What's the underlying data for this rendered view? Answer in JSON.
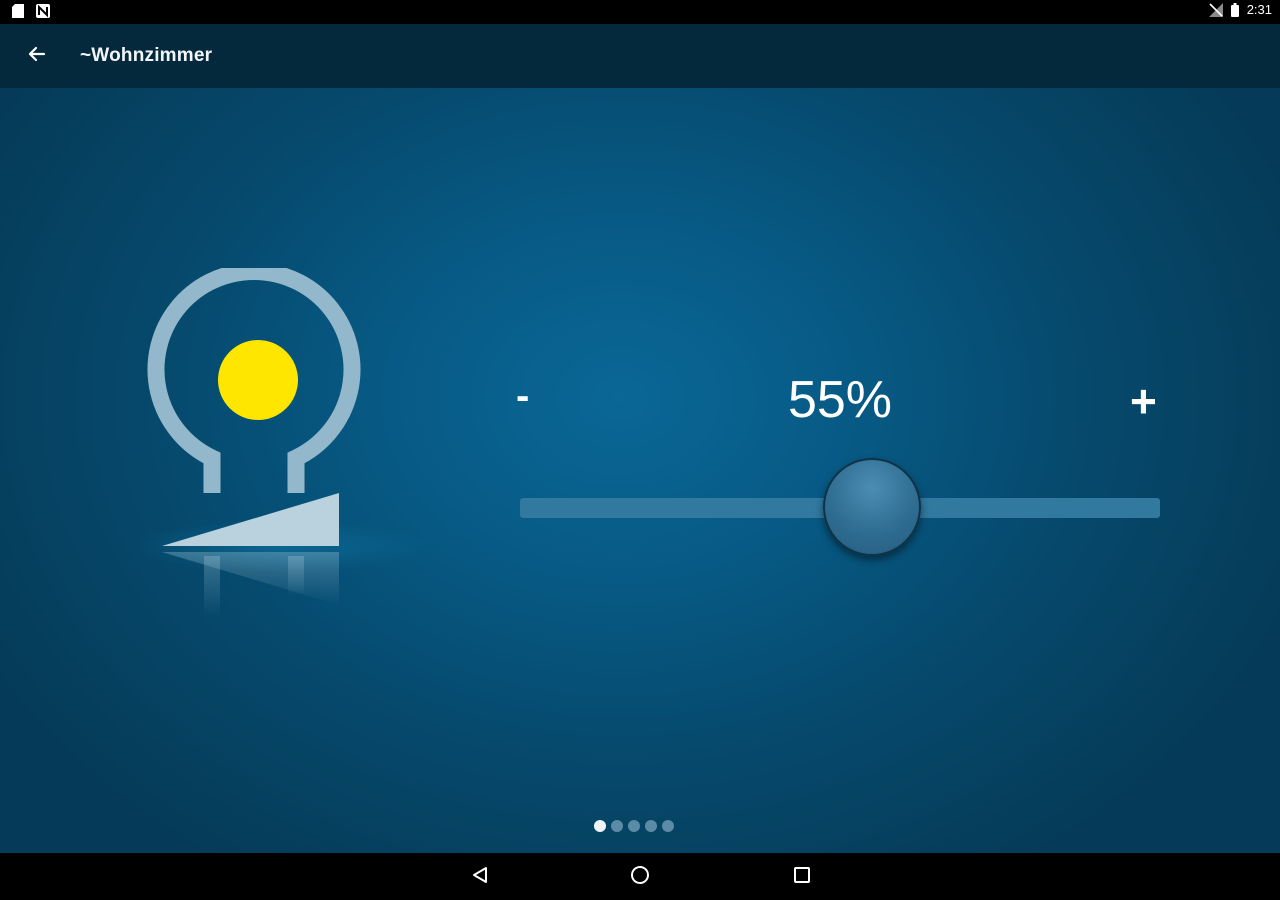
{
  "status_bar": {
    "time": "2:31",
    "left_icons": [
      "sd-card-icon",
      "nfc-icon"
    ],
    "right_icons": [
      "no-signal-icon",
      "battery-icon"
    ]
  },
  "app_bar": {
    "back_icon": "arrow-back-icon",
    "title": "~Wohnzimmer"
  },
  "dimmer": {
    "device_icon": "dimmer-lamp-icon",
    "lamp_color": "#ffe600",
    "minus_label": "-",
    "plus_label": "+",
    "value_text": "55%",
    "level": 0.55
  },
  "pager": {
    "count": 5,
    "active_index": 0
  },
  "nav_bar": {
    "icons": [
      "back-triangle-icon",
      "home-circle-icon",
      "recents-square-icon"
    ]
  },
  "colors": {
    "app_bar": "#05293c",
    "background_center": "#0a6796",
    "background_edge": "#053b58",
    "slider_track": "#31799f",
    "slider_thumb": "#2f6d92"
  }
}
